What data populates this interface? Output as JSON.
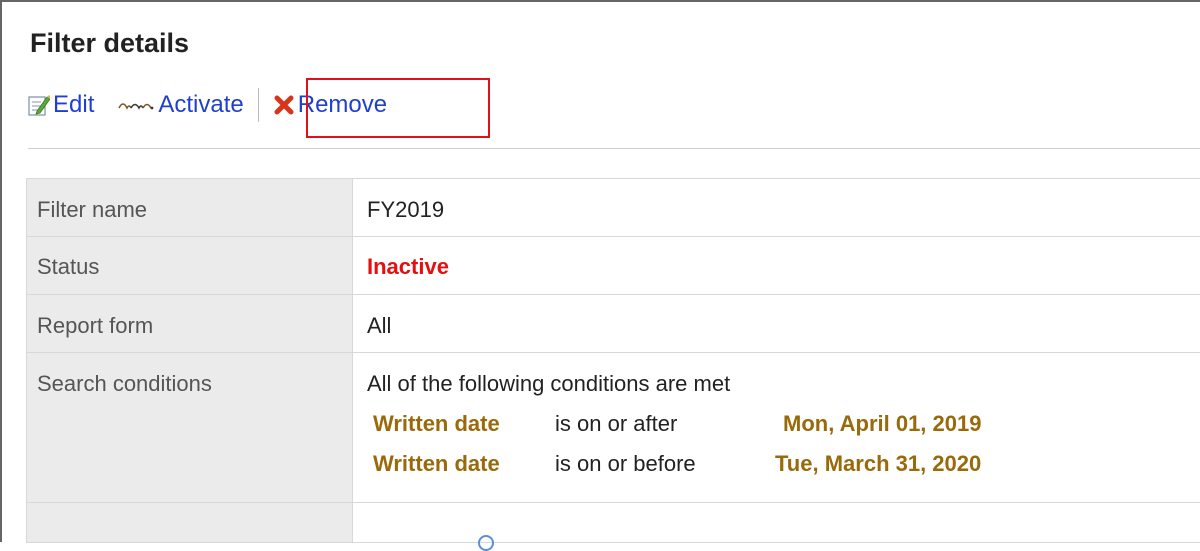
{
  "header": {
    "title": "Filter details"
  },
  "toolbar": {
    "edit_label": "Edit",
    "activate_label": "Activate",
    "remove_label": "Remove"
  },
  "details": {
    "filter_name": {
      "label": "Filter name",
      "value": "FY2019"
    },
    "status": {
      "label": "Status",
      "value": "Inactive"
    },
    "report_form": {
      "label": "Report form",
      "value": "All"
    },
    "search_conditions": {
      "label": "Search conditions",
      "summary": "All of the following conditions are met",
      "conditions": [
        {
          "field": "Written date",
          "operator": "is on or after",
          "value": "Mon, April 01, 2019"
        },
        {
          "field": "Written date",
          "operator": "is on or before",
          "value": "Tue, March 31, 2020"
        }
      ]
    }
  },
  "colors": {
    "link": "#1f3fd1",
    "status_inactive": "#e50f0f",
    "condition_highlight": "#9a6a0a",
    "highlight_box": "#e0111b",
    "label_cell_bg": "#ebebeb"
  },
  "icons": {
    "edit": "edit-icon",
    "activate": "activate-icon",
    "remove": "remove-x-icon"
  }
}
